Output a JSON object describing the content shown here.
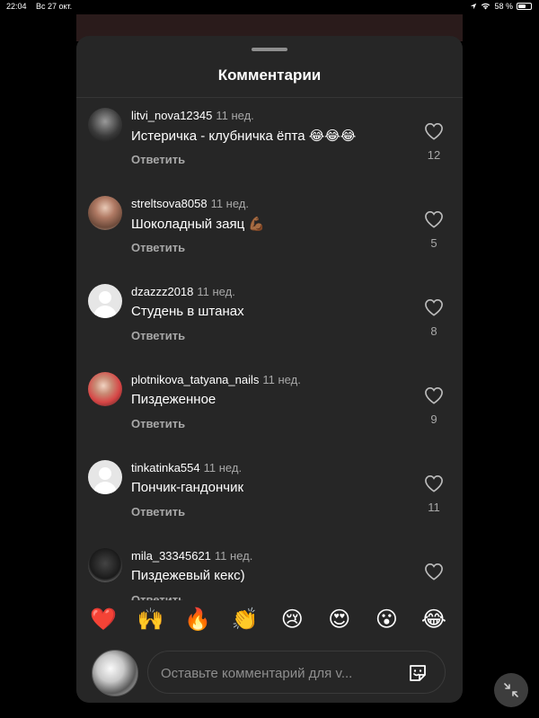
{
  "status_bar": {
    "time": "22:04",
    "date": "Вс 27 окт.",
    "battery": "58 %",
    "battery_level": 0.58
  },
  "sheet": {
    "title": "Комментарии"
  },
  "comments": [
    {
      "username": "litvi_nova12345",
      "time": "11 нед.",
      "text": "Истеричка - клубничка ёпта 😂😂😂",
      "reply": "Ответить",
      "likes": "12"
    },
    {
      "username": "streltsova8058",
      "time": "11 нед.",
      "text": "Шоколадный заяц 💪🏾",
      "reply": "Ответить",
      "likes": "5"
    },
    {
      "username": "dzazzz2018",
      "time": "11 нед.",
      "text": "Студень в штанах",
      "reply": "Ответить",
      "likes": "8"
    },
    {
      "username": "plotnikova_tatyana_nails",
      "time": "11 нед.",
      "text": "Пиздеженное",
      "reply": "Ответить",
      "likes": "9"
    },
    {
      "username": "tinkatinka554",
      "time": "11 нед.",
      "text": "Пончик-гандончик",
      "reply": "Ответить",
      "likes": "11"
    },
    {
      "username": "mila_33345621",
      "time": "11 нед.",
      "text": "Пиздежевый кекс)",
      "reply": "Ответить",
      "likes": ""
    }
  ],
  "emojis": [
    "❤️",
    "🙌",
    "🔥",
    "👏",
    "😢",
    "😍",
    "😮",
    "😂"
  ],
  "composer": {
    "placeholder": "Оставьте комментарий для v..."
  },
  "icons": {
    "like": "heart-outline-icon",
    "sticker": "sticker-icon",
    "minimize": "minimize-arrows-icon"
  }
}
